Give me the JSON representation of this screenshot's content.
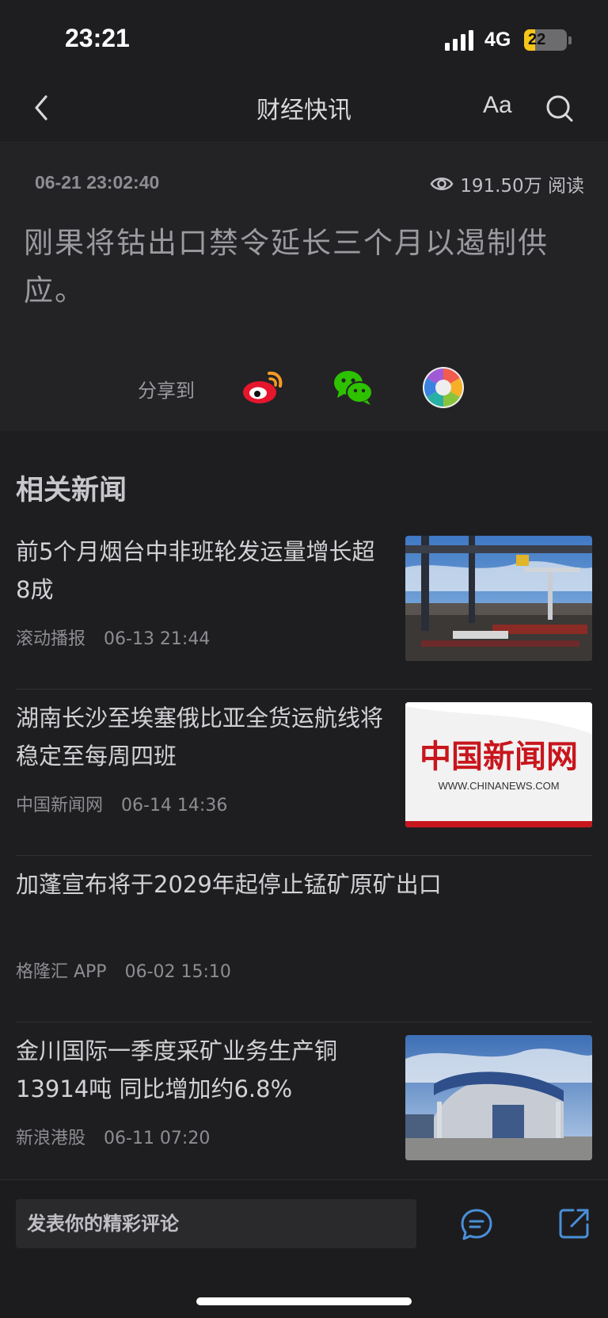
{
  "status_bar": {
    "time": "23:21",
    "network": "4G",
    "battery": "22"
  },
  "nav": {
    "title": "财经快讯",
    "font_button": "Aa",
    "icons": [
      "back-icon",
      "search-icon"
    ]
  },
  "article": {
    "datetime": "06-21 23:02:40",
    "views": "191.50万 阅读",
    "body": "刚果将钴出口禁令延长三个月以遏制供应。",
    "share_label": "分享到",
    "share_targets": [
      "weibo-icon",
      "wechat-icon",
      "moments-icon"
    ]
  },
  "related": {
    "title": "相关新闻",
    "items": [
      {
        "title": "前5个月烟台中非班轮发运量增长超8成",
        "source": "滚动播报",
        "time": "06-13 21:44",
        "thumb": "port-crane-image"
      },
      {
        "title": "湖南长沙至埃塞俄比亚全货运航线将稳定至每周四班",
        "source": "中国新闻网",
        "time": "06-14 14:36",
        "thumb": "chinanews-logo-image",
        "thumb_logo": "中国新闻网",
        "thumb_url": "WWW.CHINANEWS.COM"
      },
      {
        "title": "加蓬宣布将于2029年起停止锰矿原矿出口",
        "source": "格隆汇 APP",
        "time": "06-02 15:10"
      },
      {
        "title": "金川国际一季度采矿业务生产铜13914吨 同比增加约6.8%",
        "source": "新浪港股",
        "time": "06-11 07:20",
        "thumb": "factory-gate-image"
      }
    ]
  },
  "bottom_bar": {
    "comment_placeholder": "发表你的精彩评论",
    "icons": [
      "comment-icon",
      "share-out-icon"
    ]
  },
  "colors": {
    "background": "#1e1e20",
    "article_bg": "#232326",
    "battery": "#f5c518",
    "weibo_red": "#e6162d",
    "wechat_green": "#2dc100"
  }
}
